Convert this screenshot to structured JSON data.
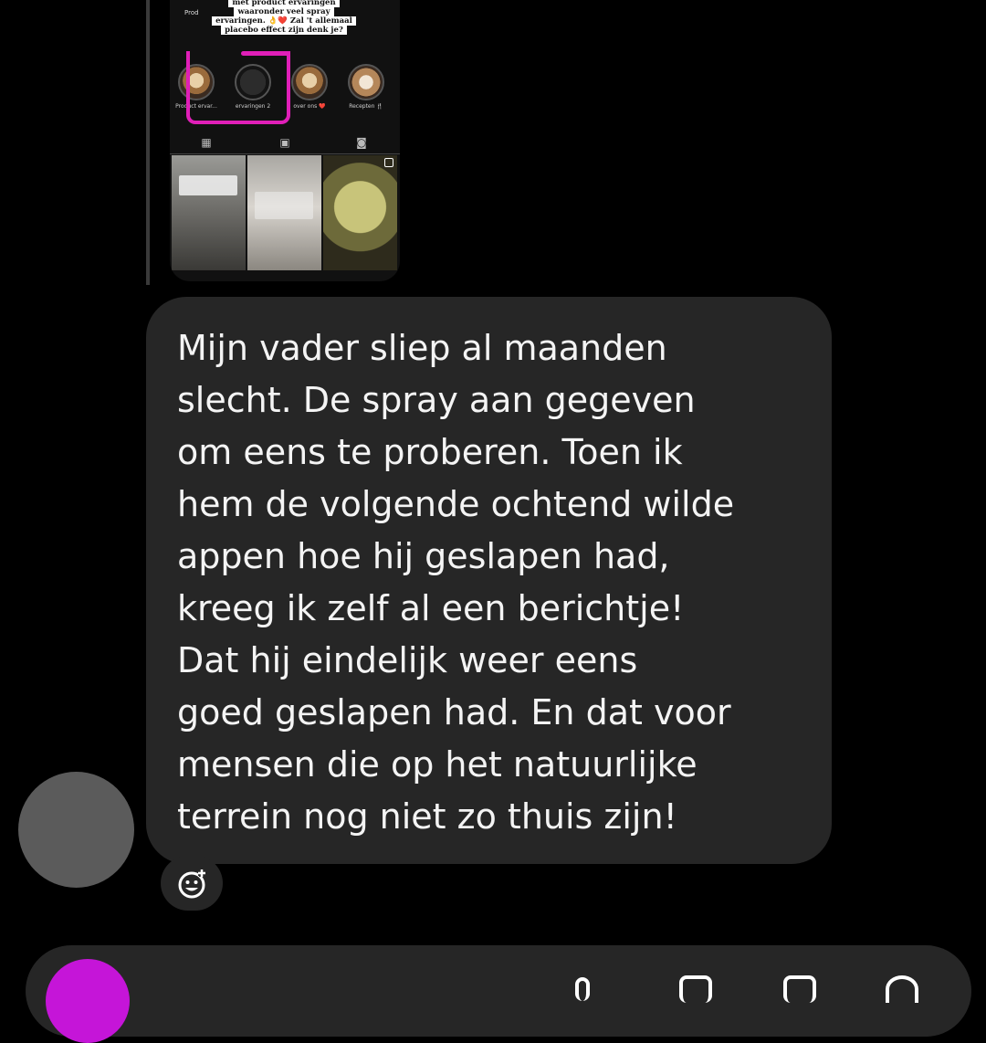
{
  "shared_story": {
    "caption_lines": [
      "met product ervaringen",
      "waaronder veel spray",
      "ervaringen. 👌❤️ Zal 't allemaal",
      "placebo effect zijn denk je?"
    ],
    "side_label": "Prod",
    "highlights": [
      {
        "label": "Product ervar..."
      },
      {
        "label": "ervaringen 2"
      },
      {
        "label": "over ons ❤️"
      },
      {
        "label": "Recepten 🍴"
      }
    ]
  },
  "message": {
    "lines": [
      "Mijn vader sliep al maanden",
      "slecht. De spray aan gegeven",
      "om eens te proberen. Toen ik",
      "hem de volgende ochtend wilde",
      "appen hoe hij geslapen had,",
      "kreeg ik zelf al een berichtje!",
      "Dat hij eindelijk weer eens",
      "goed geslapen had. En dat voor",
      "mensen die op het natuurlijke",
      "terrein nog niet zo thuis zijn!"
    ]
  },
  "icons": {
    "reaction": "add-reaction-icon",
    "camera": "camera-icon",
    "mic": "microphone-icon",
    "gallery": "gallery-icon",
    "sticker": "sticker-icon"
  },
  "colors": {
    "background": "#000000",
    "bubble": "#262626",
    "camera_button": "#c515d8",
    "highlight_marker": "#e01fb8"
  }
}
